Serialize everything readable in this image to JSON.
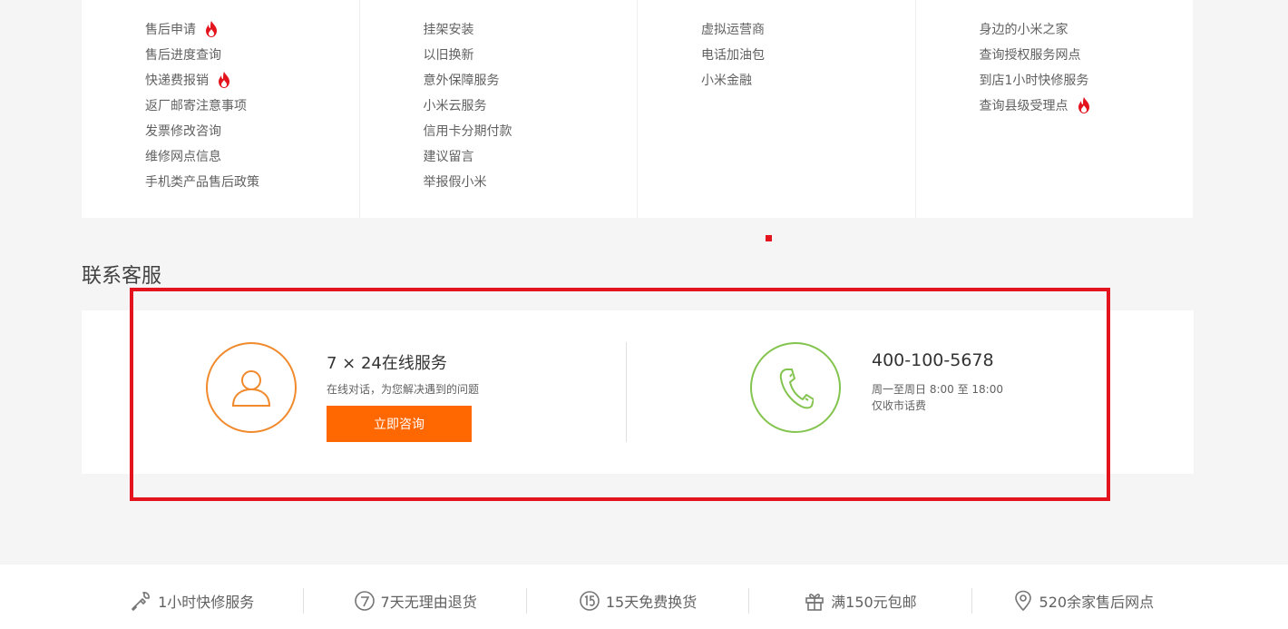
{
  "links": {
    "columns": [
      [
        {
          "label": "售后申请",
          "hot": true
        },
        {
          "label": "售后进度查询",
          "hot": false
        },
        {
          "label": "快递费报销",
          "hot": true
        },
        {
          "label": "返厂邮寄注意事项",
          "hot": false
        },
        {
          "label": "发票修改咨询",
          "hot": false
        },
        {
          "label": "维修网点信息",
          "hot": false
        },
        {
          "label": "手机类产品售后政策",
          "hot": false
        }
      ],
      [
        {
          "label": "挂架安装",
          "hot": false
        },
        {
          "label": "以旧换新",
          "hot": false
        },
        {
          "label": "意外保障服务",
          "hot": false
        },
        {
          "label": "小米云服务",
          "hot": false
        },
        {
          "label": "信用卡分期付款",
          "hot": false
        },
        {
          "label": "建议留言",
          "hot": false
        },
        {
          "label": "举报假小米",
          "hot": false
        }
      ],
      [
        {
          "label": "虚拟运营商",
          "hot": false
        },
        {
          "label": "电话加油包",
          "hot": false
        },
        {
          "label": "小米金融",
          "hot": false
        }
      ],
      [
        {
          "label": "身边的小米之家",
          "hot": false
        },
        {
          "label": "查询授权服务网点",
          "hot": false
        },
        {
          "label": "到店1小时快修服务",
          "hot": false
        },
        {
          "label": "查询县级受理点",
          "hot": true
        }
      ]
    ]
  },
  "contact": {
    "section_title": "联系客服",
    "online": {
      "title": "7 × 24在线服务",
      "desc": "在线对话，为您解决遇到的问题",
      "button": "立即咨询",
      "icon": "user-icon"
    },
    "phone": {
      "number": "400-100-5678",
      "hours": "周一至周日 8:00 至 18:00",
      "fee": "仅收市话费",
      "icon": "phone-icon"
    }
  },
  "footer": {
    "items": [
      {
        "label": "1小时快修服务",
        "icon": "wrench-icon"
      },
      {
        "label": "7天无理由退货",
        "icon": "seven-day-icon"
      },
      {
        "label": "15天免费换货",
        "icon": "fifteen-day-icon"
      },
      {
        "label": "满150元包邮",
        "icon": "gift-icon"
      },
      {
        "label": "520余家售后网点",
        "icon": "location-icon"
      }
    ]
  },
  "colors": {
    "accent": "#ff6700",
    "highlight": "#e4141e",
    "online_ring": "#f08a2c",
    "phone_ring": "#83c44e"
  }
}
